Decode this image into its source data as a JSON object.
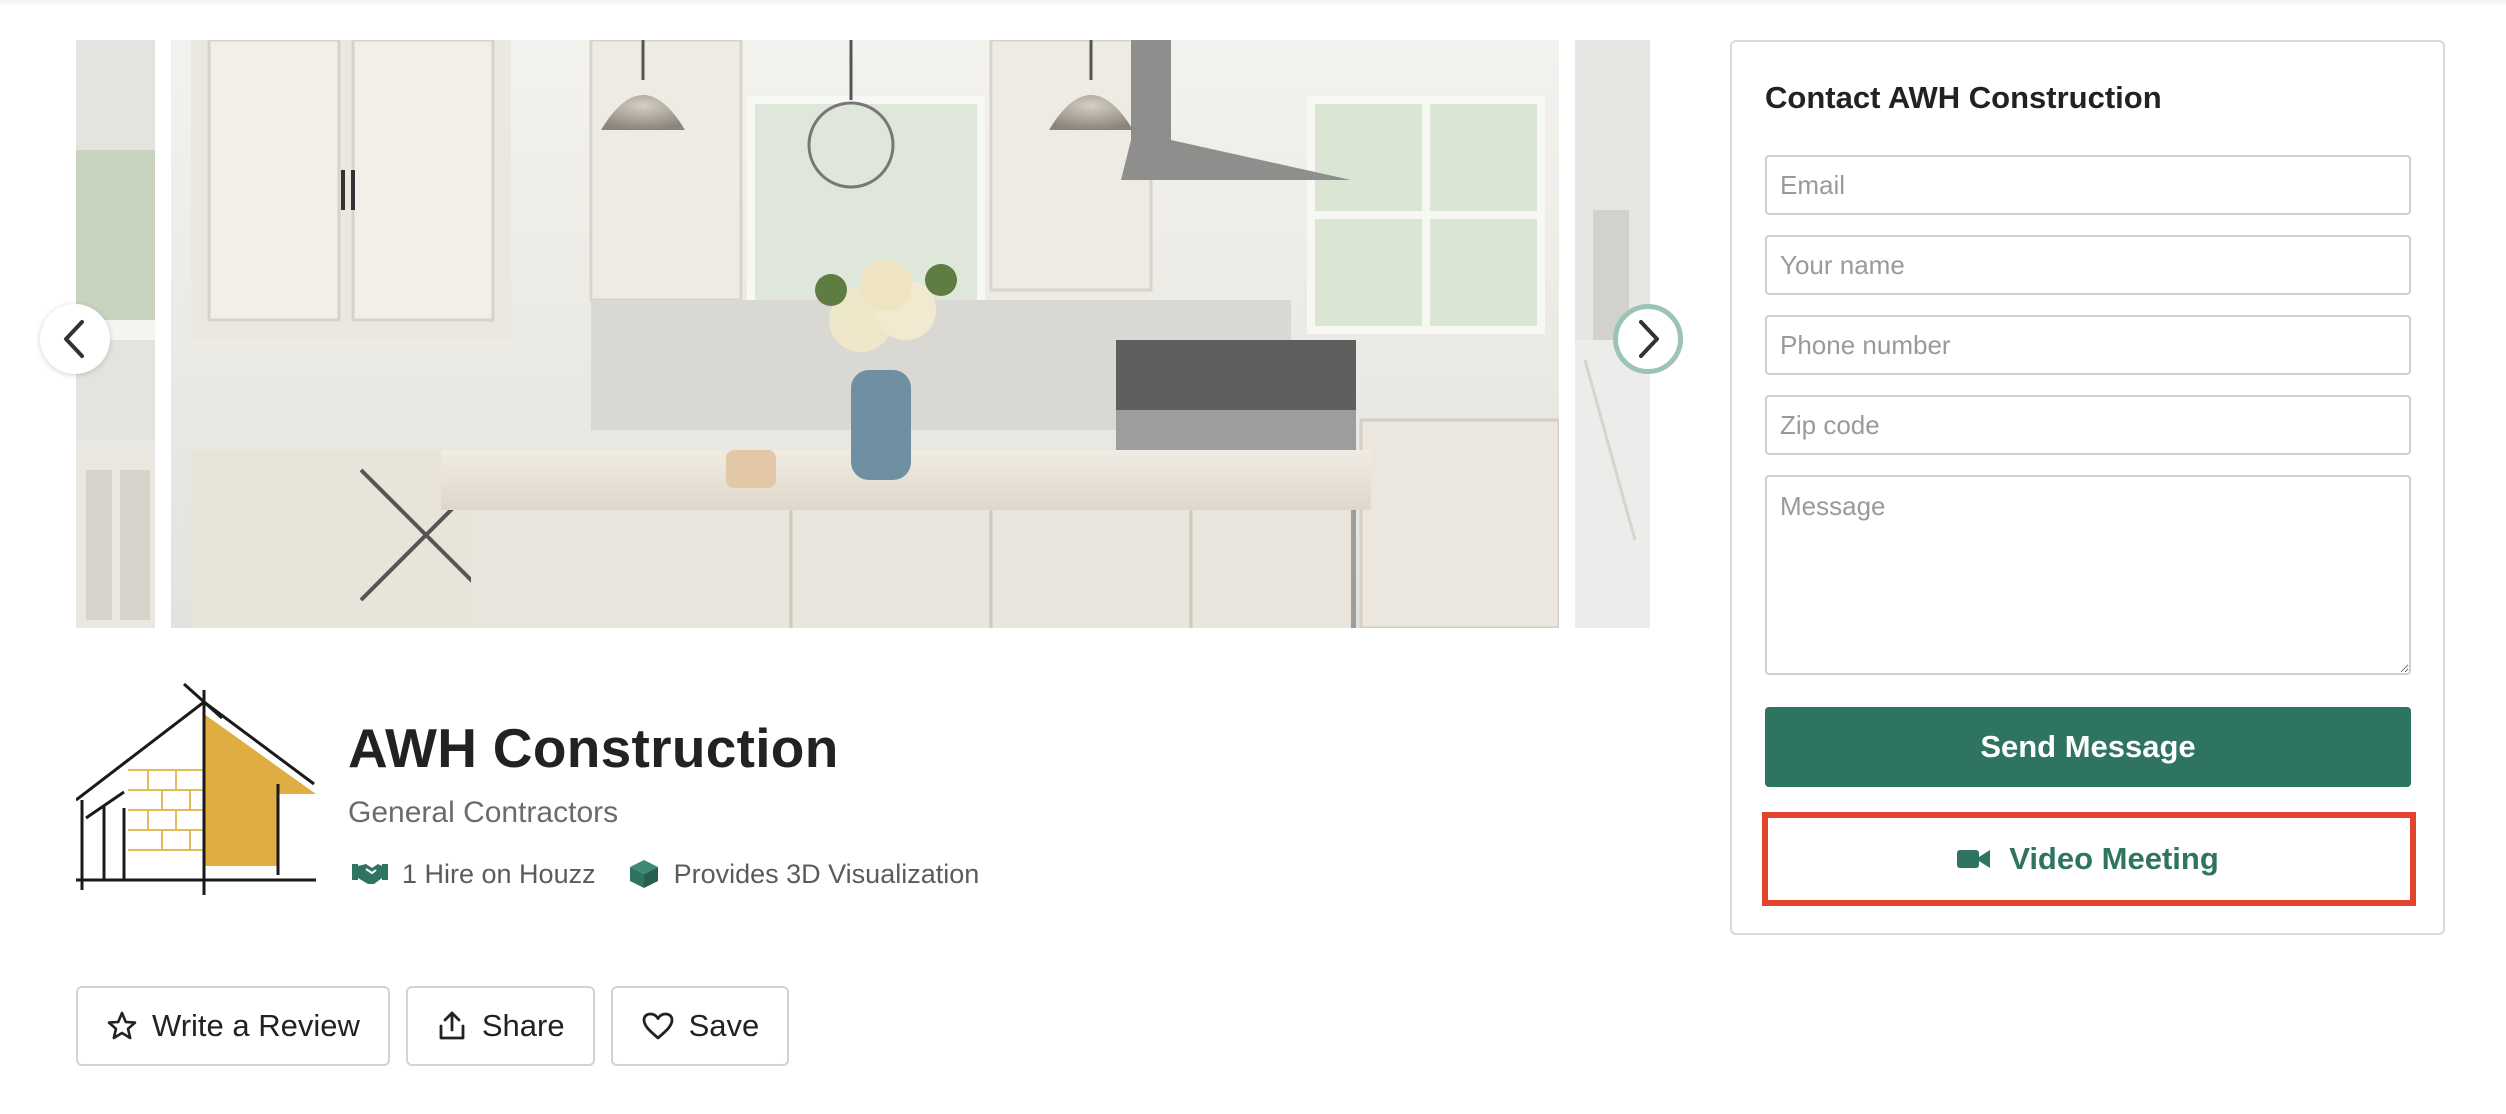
{
  "gallery": {
    "prev_icon": "chevron-left-icon",
    "next_icon": "chevron-right-icon"
  },
  "business": {
    "name": "AWH Construction",
    "category": "General Contractors",
    "badges": [
      {
        "icon": "handshake-icon",
        "label": "1 Hire on Houzz"
      },
      {
        "icon": "cube-icon",
        "label": "Provides 3D Visualization"
      }
    ]
  },
  "actions": {
    "review_label": "Write a Review",
    "share_label": "Share",
    "save_label": "Save"
  },
  "contact": {
    "title": "Contact AWH Construction",
    "email_placeholder": "Email",
    "name_placeholder": "Your name",
    "phone_placeholder": "Phone number",
    "zip_placeholder": "Zip code",
    "message_placeholder": "Message",
    "send_label": "Send Message",
    "video_label": "Video Meeting"
  },
  "colors": {
    "brand_green": "#2f7461",
    "highlight": "#e4432d",
    "logo_gold": "#e0ad42"
  }
}
